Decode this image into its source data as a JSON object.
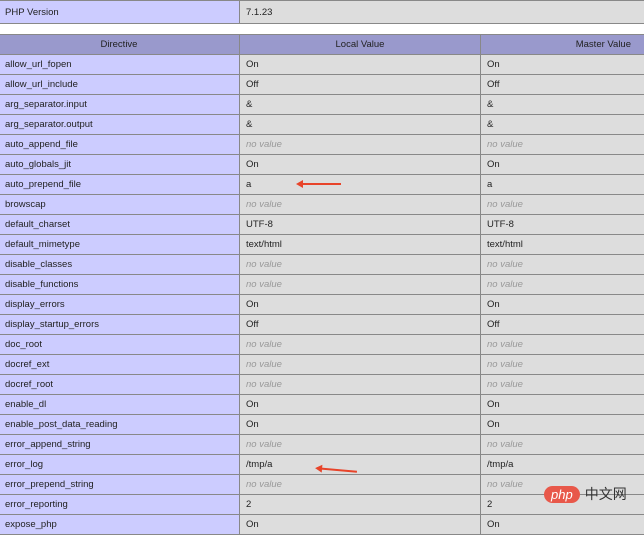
{
  "version": {
    "label": "PHP Version",
    "value": "7.1.23"
  },
  "headers": [
    "Directive",
    "Local Value",
    "Master Value"
  ],
  "rows": [
    [
      "allow_url_fopen",
      "On",
      "On"
    ],
    [
      "allow_url_include",
      "Off",
      "Off"
    ],
    [
      "arg_separator.input",
      "&",
      "&"
    ],
    [
      "arg_separator.output",
      "&",
      "&"
    ],
    [
      "auto_append_file",
      "no value",
      "no value"
    ],
    [
      "auto_globals_jit",
      "On",
      "On"
    ],
    [
      "auto_prepend_file",
      "a",
      "a"
    ],
    [
      "browscap",
      "no value",
      "no value"
    ],
    [
      "default_charset",
      "UTF-8",
      "UTF-8"
    ],
    [
      "default_mimetype",
      "text/html",
      "text/html"
    ],
    [
      "disable_classes",
      "no value",
      "no value"
    ],
    [
      "disable_functions",
      "no value",
      "no value"
    ],
    [
      "display_errors",
      "On",
      "On"
    ],
    [
      "display_startup_errors",
      "Off",
      "Off"
    ],
    [
      "doc_root",
      "no value",
      "no value"
    ],
    [
      "docref_ext",
      "no value",
      "no value"
    ],
    [
      "docref_root",
      "no value",
      "no value"
    ],
    [
      "enable_dl",
      "On",
      "On"
    ],
    [
      "enable_post_data_reading",
      "On",
      "On"
    ],
    [
      "error_append_string",
      "no value",
      "no value"
    ],
    [
      "error_log",
      "/tmp/a",
      "/tmp/a"
    ],
    [
      "error_prepend_string",
      "no value",
      "no value"
    ],
    [
      "error_reporting",
      "2",
      "2"
    ],
    [
      "expose_php",
      "On",
      "On"
    ]
  ],
  "watermark": {
    "logo": "php",
    "text": "中文网"
  },
  "colors": {
    "header": "#9999cc",
    "directive": "#ccccff",
    "value": "#dddddd",
    "arrow": "#e8442a"
  }
}
